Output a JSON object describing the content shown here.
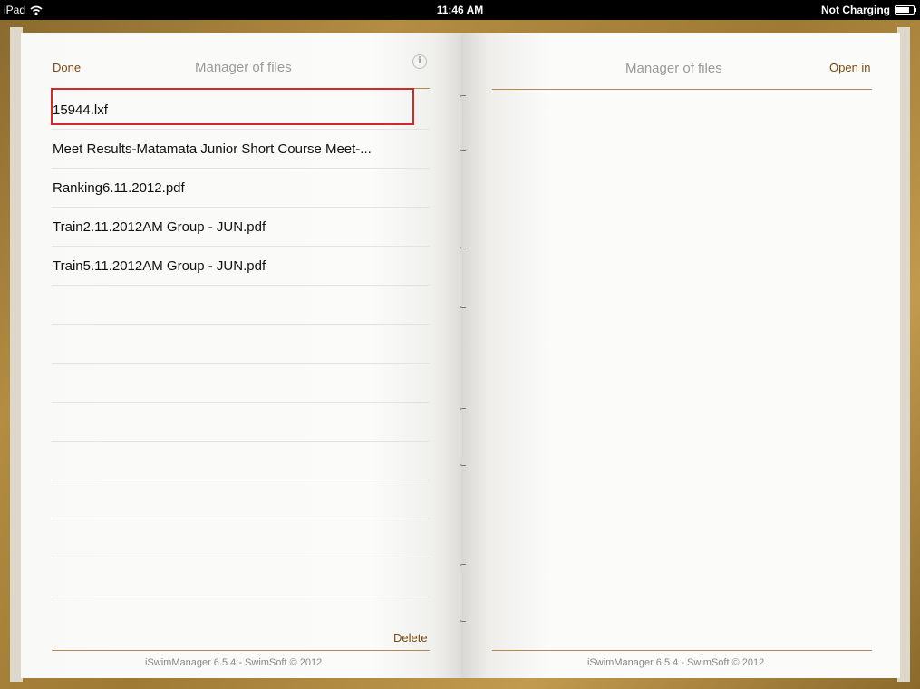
{
  "status_bar": {
    "device": "iPad",
    "time": "11:46 AM",
    "battery_text": "Not Charging"
  },
  "left_page": {
    "done_label": "Done",
    "title": "Manager of files",
    "files": [
      "15944.lxf",
      "Meet Results-Matamata Junior Short Course Meet-...",
      "Ranking6.11.2012.pdf",
      "Train2.11.2012AM Group - JUN.pdf",
      "Train5.11.2012AM Group - JUN.pdf",
      "",
      "",
      "",
      "",
      "",
      "",
      "",
      "",
      ""
    ],
    "selected_index": 0,
    "delete_label": "Delete",
    "footer": "iSwimManager  6.5.4 - SwimSoft © 2012"
  },
  "right_page": {
    "title": "Manager of files",
    "open_in_label": "Open in",
    "footer": "iSwimManager  6.5.4 - SwimSoft © 2012"
  },
  "colors": {
    "accent_link": "#7a4a12",
    "divider_gold": "#b58a4e",
    "selection_outline": "#d02a2a"
  }
}
